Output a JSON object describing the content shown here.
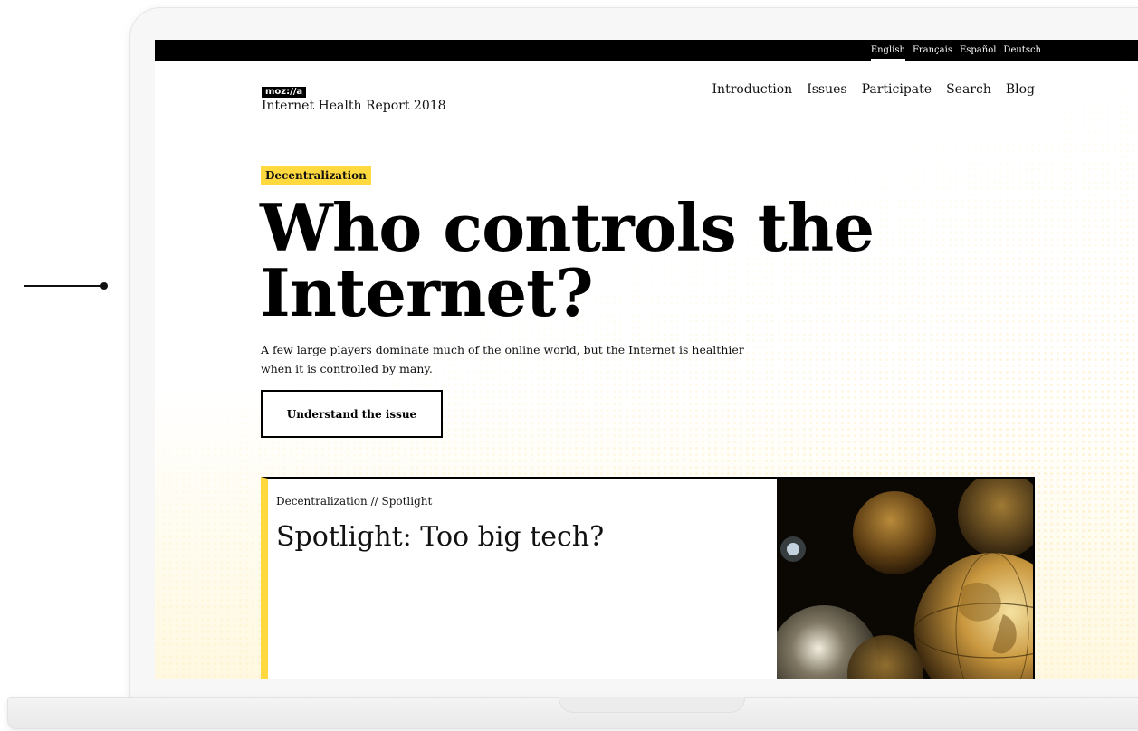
{
  "lang_bar": {
    "items": [
      "English",
      "Français",
      "Español",
      "Deutsch"
    ],
    "active": "English"
  },
  "brand": {
    "logo": "moz://a",
    "title": "Internet Health Report 2018"
  },
  "nav": {
    "items": [
      "Introduction",
      "Issues",
      "Participate",
      "Search",
      "Blog"
    ]
  },
  "hero": {
    "tag": "Decentralization",
    "title": "Who controls the Internet?",
    "description": "A few large players dominate much of the online world, but the Internet is healthier when it is controlled by many.",
    "button": "Understand the issue"
  },
  "spotlight": {
    "meta": "Decentralization // Spotlight",
    "title": "Spotlight: Too big tech?",
    "image": "globes-photo"
  },
  "colors": {
    "accent": "#ffd93d",
    "bar": "#000000",
    "text": "#111111"
  }
}
